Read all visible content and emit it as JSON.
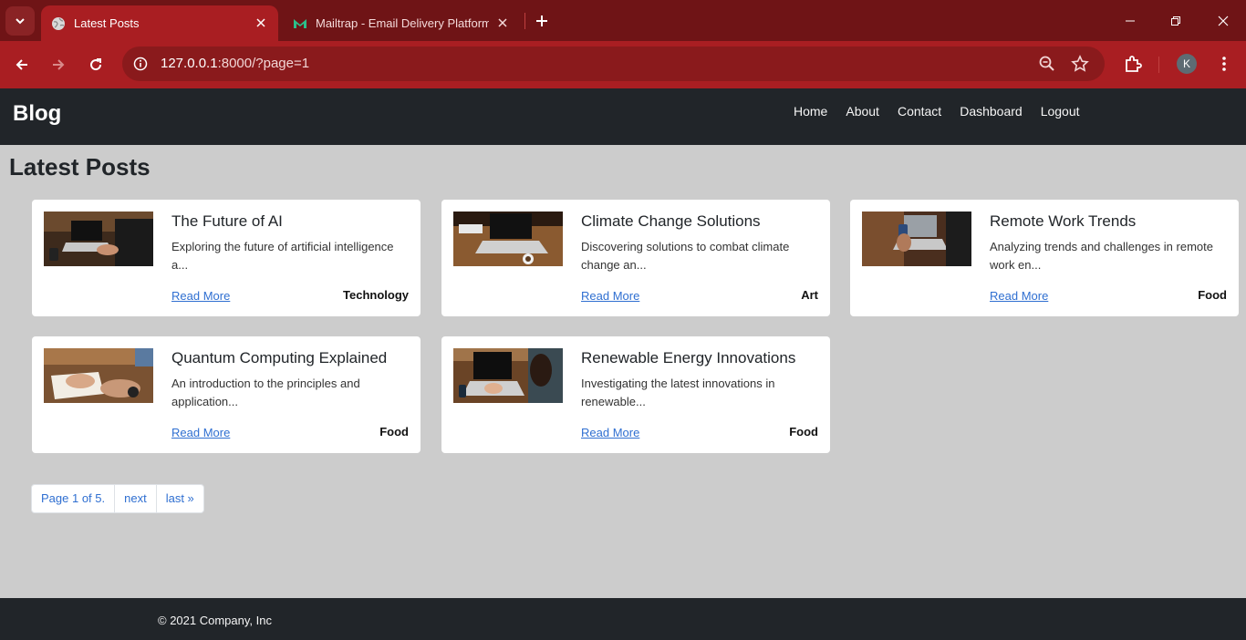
{
  "browser": {
    "tabs": [
      {
        "title": "Latest Posts",
        "active": true
      },
      {
        "title": "Mailtrap - Email Delivery Platform",
        "active": false
      }
    ],
    "url_host": "127.0.0.1",
    "url_rest": ":8000/?page=1",
    "profile_initial": "K"
  },
  "site": {
    "brand": "Blog",
    "nav": [
      "Home",
      "About",
      "Contact",
      "Dashboard",
      "Logout"
    ]
  },
  "main": {
    "heading": "Latest Posts",
    "posts": [
      {
        "title": "The Future of AI",
        "excerpt": "Exploring the future of artificial intelligence a...",
        "read_more": "Read More",
        "category": "Technology"
      },
      {
        "title": "Climate Change Solutions",
        "excerpt": "Discovering solutions to combat climate change an...",
        "read_more": "Read More",
        "category": "Art"
      },
      {
        "title": "Remote Work Trends",
        "excerpt": "Analyzing trends and challenges in remote work en...",
        "read_more": "Read More",
        "category": "Food"
      },
      {
        "title": "Quantum Computing Explained",
        "excerpt": "An introduction to the principles and application...",
        "read_more": "Read More",
        "category": "Food"
      },
      {
        "title": "Renewable Energy Innovations",
        "excerpt": "Investigating the latest innovations in renewable...",
        "read_more": "Read More",
        "category": "Food"
      }
    ],
    "pagination": {
      "current": "Page 1 of 5.",
      "next": "next",
      "last": "last »"
    }
  },
  "footer": {
    "copyright": "© 2021 Company, Inc"
  },
  "colors": {
    "chrome_dark": "#6f1416",
    "chrome": "#a91e22",
    "navbar": "#212529",
    "page_bg": "#cccccc",
    "link": "#2f6fd1"
  }
}
